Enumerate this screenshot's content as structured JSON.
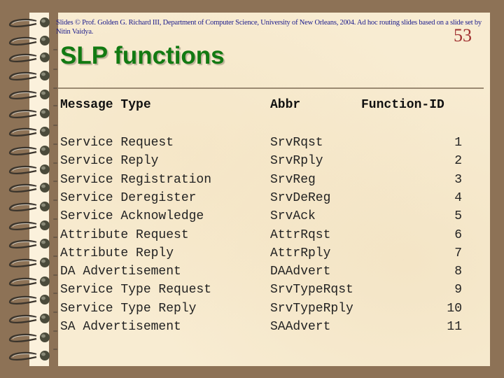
{
  "slide": {
    "credit": "Slides © Prof. Golden G. Richard III, Department of Computer Science, University of New Orleans, 2004.  Ad hoc routing slides based on a slide set by Nitin Vaidya.",
    "slide_number": "53",
    "title": "SLP functions",
    "colors": {
      "background": "#8d7256",
      "paper": "#f8ecd2",
      "title": "#127a12",
      "credit": "#1a1a8c",
      "slide_number": "#a03030"
    }
  },
  "table": {
    "headers": [
      "Message Type",
      "Abbr",
      "Function-ID"
    ],
    "rows": [
      {
        "type": "Service Request",
        "abbr": "SrvRqst",
        "id": "1"
      },
      {
        "type": "Service Reply",
        "abbr": "SrvRply",
        "id": "2"
      },
      {
        "type": "Service Registration",
        "abbr": "SrvReg",
        "id": "3"
      },
      {
        "type": "Service Deregister",
        "abbr": "SrvDeReg",
        "id": "4"
      },
      {
        "type": "Service Acknowledge",
        "abbr": "SrvAck",
        "id": "5"
      },
      {
        "type": "Attribute Request",
        "abbr": "AttrRqst",
        "id": "6"
      },
      {
        "type": "Attribute Reply",
        "abbr": "AttrRply",
        "id": "7"
      },
      {
        "type": "DA Advertisement",
        "abbr": "DAAdvert",
        "id": "8"
      },
      {
        "type": "Service Type Request",
        "abbr": "SrvTypeRqst",
        "id": "9"
      },
      {
        "type": "Service Type Reply",
        "abbr": "SrvTypeRply",
        "id": "10"
      },
      {
        "type": "SA Advertisement",
        "abbr": "SAAdvert",
        "id": "11"
      }
    ]
  }
}
